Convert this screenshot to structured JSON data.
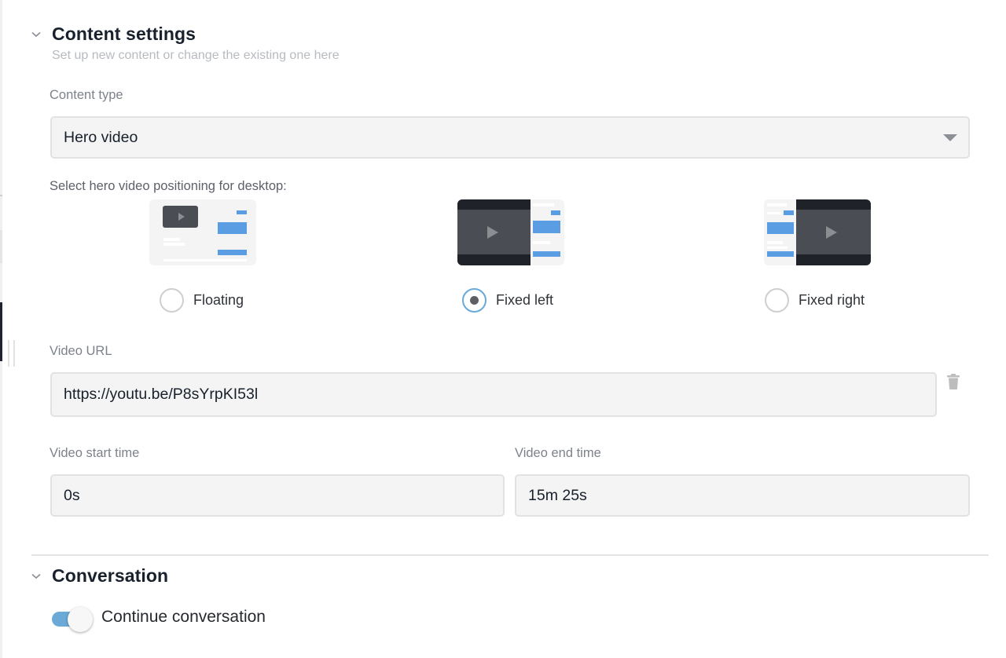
{
  "content_settings": {
    "title": "Content settings",
    "subtitle": "Set up new content or change the existing one here",
    "content_type": {
      "label": "Content type",
      "selected": "Hero video"
    },
    "positioning": {
      "label": "Select hero video positioning for desktop:",
      "options": [
        {
          "label": "Floating",
          "selected": false
        },
        {
          "label": "Fixed left",
          "selected": true
        },
        {
          "label": "Fixed right",
          "selected": false
        }
      ]
    },
    "video_url": {
      "label": "Video URL",
      "value": "https://youtu.be/P8sYrpKI53l"
    },
    "video_start_time": {
      "label": "Video start time",
      "value": "0s"
    },
    "video_end_time": {
      "label": "Video end time",
      "value": "15m 25s"
    }
  },
  "conversation": {
    "title": "Conversation",
    "continue_conversation": {
      "label": "Continue conversation",
      "enabled": true
    }
  },
  "colors": {
    "accent": "#6ba9d6",
    "thumbnail_blue": "#5b9de3",
    "video_dark": "#1f2329"
  }
}
